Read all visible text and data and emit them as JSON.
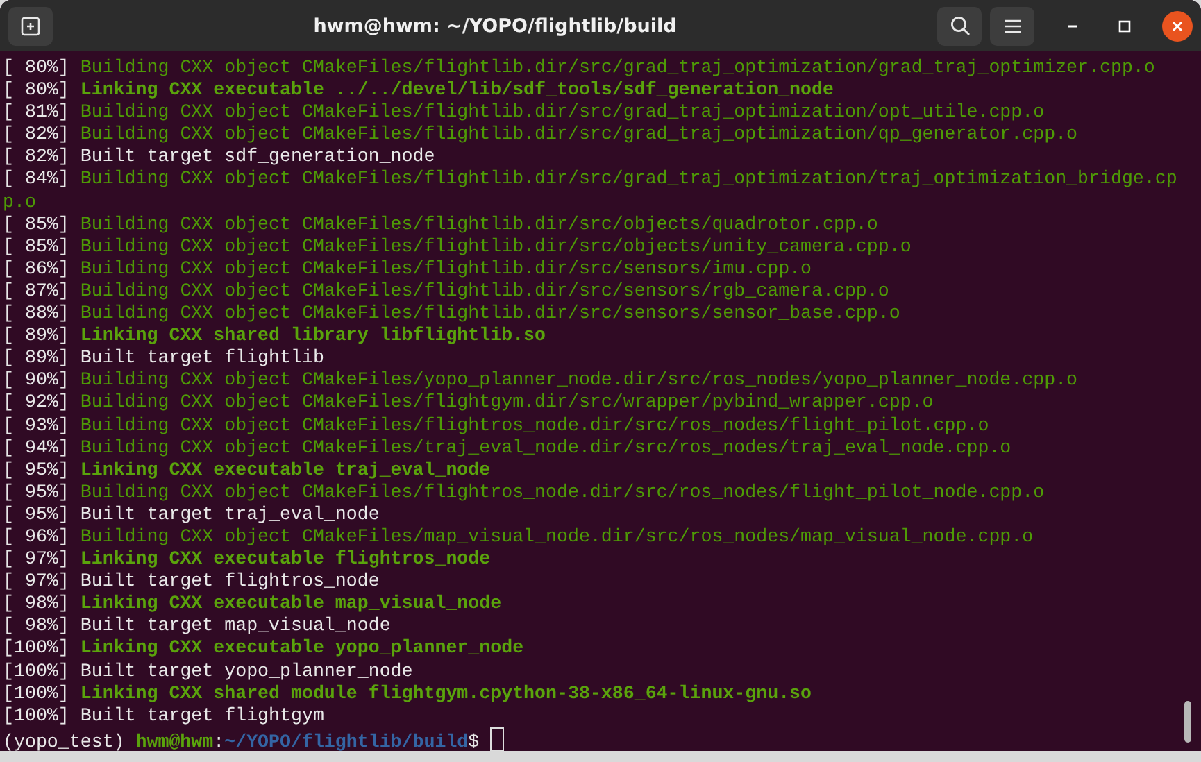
{
  "window": {
    "title": "hwm@hwm: ~/YOPO/flightlib/build"
  },
  "lines": [
    {
      "kind": "build",
      "progress": "[ 80%]",
      "text": "Building CXX object CMakeFiles/flightlib.dir/src/grad_traj_optimization/grad_traj_optimizer.cpp.o"
    },
    {
      "kind": "link",
      "progress": "[ 80%]",
      "text": "Linking CXX executable ../../devel/lib/sdf_tools/sdf_generation_node"
    },
    {
      "kind": "build",
      "progress": "[ 81%]",
      "text": "Building CXX object CMakeFiles/flightlib.dir/src/grad_traj_optimization/opt_utile.cpp.o"
    },
    {
      "kind": "build",
      "progress": "[ 82%]",
      "text": "Building CXX object CMakeFiles/flightlib.dir/src/grad_traj_optimization/qp_generator.cpp.o"
    },
    {
      "kind": "built",
      "progress": "[ 82%]",
      "text": "Built target sdf_generation_node"
    },
    {
      "kind": "build",
      "progress": "[ 84%]",
      "text": "Building CXX object CMakeFiles/flightlib.dir/src/grad_traj_optimization/traj_optimization_bridge.cpp.o"
    },
    {
      "kind": "build",
      "progress": "[ 85%]",
      "text": "Building CXX object CMakeFiles/flightlib.dir/src/objects/quadrotor.cpp.o"
    },
    {
      "kind": "build",
      "progress": "[ 85%]",
      "text": "Building CXX object CMakeFiles/flightlib.dir/src/objects/unity_camera.cpp.o"
    },
    {
      "kind": "build",
      "progress": "[ 86%]",
      "text": "Building CXX object CMakeFiles/flightlib.dir/src/sensors/imu.cpp.o"
    },
    {
      "kind": "build",
      "progress": "[ 87%]",
      "text": "Building CXX object CMakeFiles/flightlib.dir/src/sensors/rgb_camera.cpp.o"
    },
    {
      "kind": "build",
      "progress": "[ 88%]",
      "text": "Building CXX object CMakeFiles/flightlib.dir/src/sensors/sensor_base.cpp.o"
    },
    {
      "kind": "link",
      "progress": "[ 89%]",
      "text": "Linking CXX shared library libflightlib.so"
    },
    {
      "kind": "built",
      "progress": "[ 89%]",
      "text": "Built target flightlib"
    },
    {
      "kind": "build",
      "progress": "[ 90%]",
      "text": "Building CXX object CMakeFiles/yopo_planner_node.dir/src/ros_nodes/yopo_planner_node.cpp.o"
    },
    {
      "kind": "build",
      "progress": "[ 92%]",
      "text": "Building CXX object CMakeFiles/flightgym.dir/src/wrapper/pybind_wrapper.cpp.o"
    },
    {
      "kind": "build",
      "progress": "[ 93%]",
      "text": "Building CXX object CMakeFiles/flightros_node.dir/src/ros_nodes/flight_pilot.cpp.o"
    },
    {
      "kind": "build",
      "progress": "[ 94%]",
      "text": "Building CXX object CMakeFiles/traj_eval_node.dir/src/ros_nodes/traj_eval_node.cpp.o"
    },
    {
      "kind": "link",
      "progress": "[ 95%]",
      "text": "Linking CXX executable traj_eval_node"
    },
    {
      "kind": "build",
      "progress": "[ 95%]",
      "text": "Building CXX object CMakeFiles/flightros_node.dir/src/ros_nodes/flight_pilot_node.cpp.o"
    },
    {
      "kind": "built",
      "progress": "[ 95%]",
      "text": "Built target traj_eval_node"
    },
    {
      "kind": "build",
      "progress": "[ 96%]",
      "text": "Building CXX object CMakeFiles/map_visual_node.dir/src/ros_nodes/map_visual_node.cpp.o"
    },
    {
      "kind": "link",
      "progress": "[ 97%]",
      "text": "Linking CXX executable flightros_node"
    },
    {
      "kind": "built",
      "progress": "[ 97%]",
      "text": "Built target flightros_node"
    },
    {
      "kind": "link",
      "progress": "[ 98%]",
      "text": "Linking CXX executable map_visual_node"
    },
    {
      "kind": "built",
      "progress": "[ 98%]",
      "text": "Built target map_visual_node"
    },
    {
      "kind": "link",
      "progress": "[100%]",
      "text": "Linking CXX executable yopo_planner_node"
    },
    {
      "kind": "built",
      "progress": "[100%]",
      "text": "Built target yopo_planner_node"
    },
    {
      "kind": "link",
      "progress": "[100%]",
      "text": "Linking CXX shared module flightgym.cpython-38-x86_64-linux-gnu.so"
    },
    {
      "kind": "built",
      "progress": "[100%]",
      "text": "Built target flightgym"
    }
  ],
  "prompt": {
    "env": "(yopo_test)",
    "user_host": "hwm@hwm",
    "separator": ":",
    "path": "~/YOPO/flightlib/build",
    "symbol": "$"
  }
}
